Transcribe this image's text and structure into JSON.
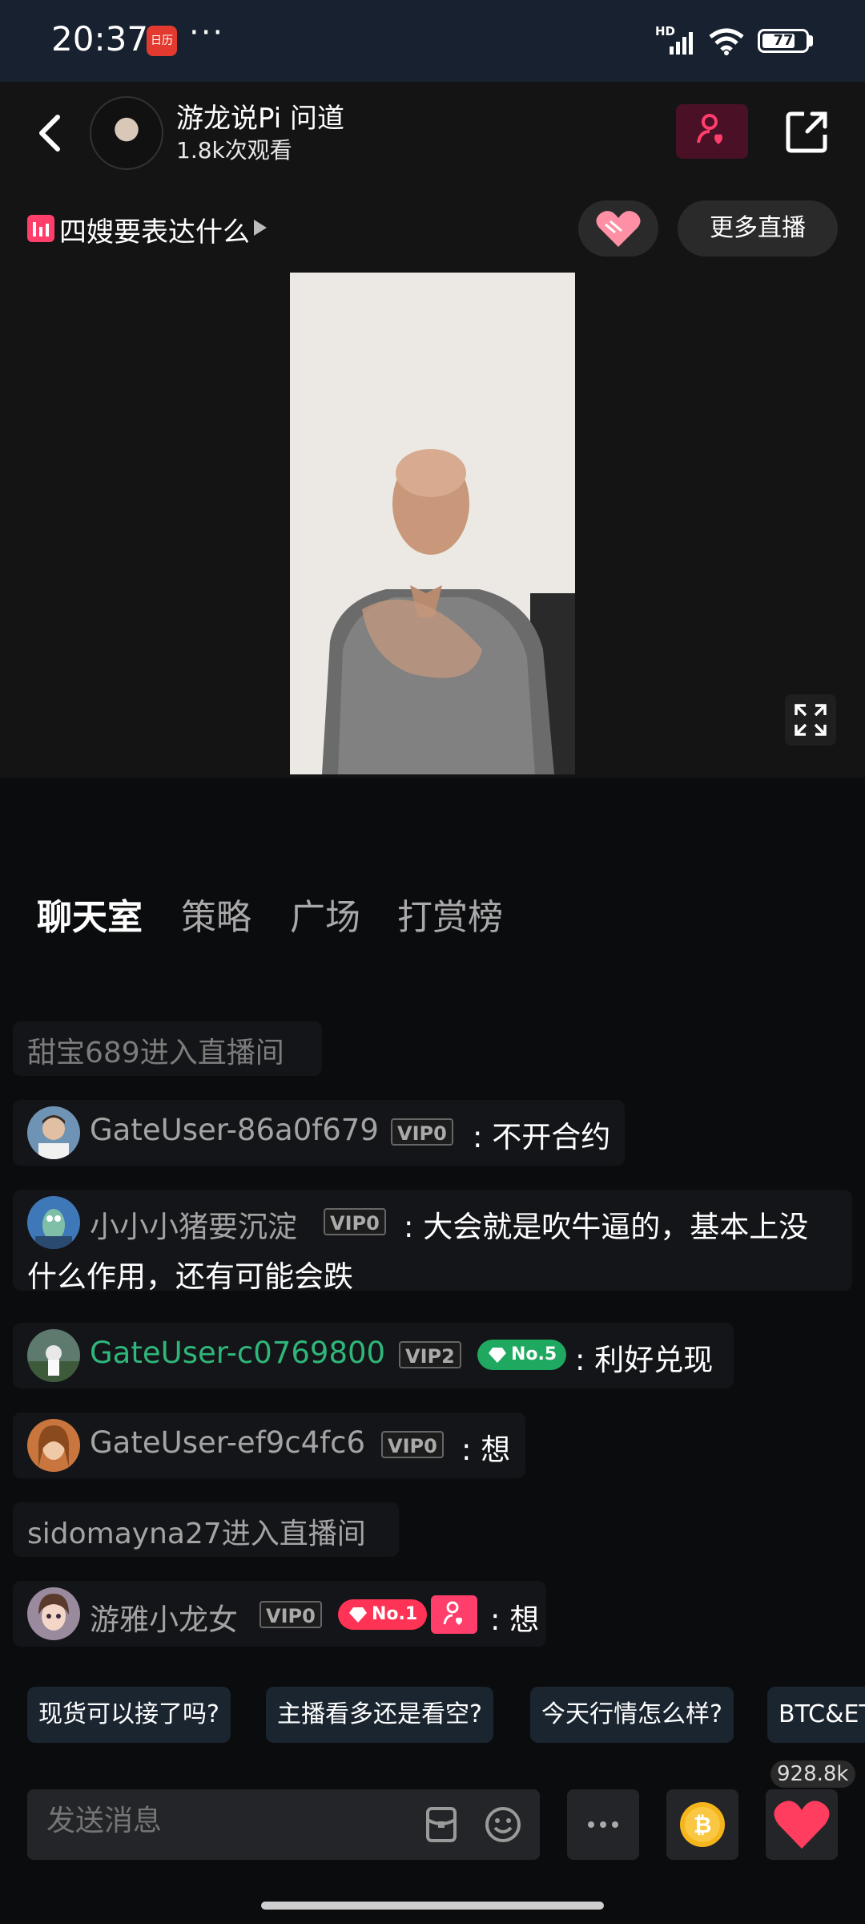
{
  "status_bar": {
    "time": "20:37",
    "notification_app_icon": "calendar-app-icon",
    "more_indicator": "···",
    "hd_label": "HD",
    "battery_level": "77",
    "battery_fraction": 0.77
  },
  "header": {
    "streamer_name": "游龙说Pi  问道",
    "viewer_count": "1.8k次观看"
  },
  "topic": {
    "text": "四嫂要表达什么",
    "more_live_label": "更多直播"
  },
  "tabs": [
    {
      "label": "聊天室",
      "active": true
    },
    {
      "label": "策略",
      "active": false
    },
    {
      "label": "广场",
      "active": false
    },
    {
      "label": "打赏榜",
      "active": false
    }
  ],
  "chat": {
    "enter1": "甜宝689进入直播间",
    "msg1": {
      "user": "GateUser-86a0f679",
      "vip": "VIP0",
      "text": ": 不开合约"
    },
    "msg2": {
      "user": "小小小猪要沉淀",
      "vip": "VIP0",
      "text_line1": ": 大会就是吹牛逼的，基本上没",
      "text_line2": "什么作用，还有可能会跌"
    },
    "msg3": {
      "user": "GateUser-c0769800",
      "vip": "VIP2",
      "badge": "No.5",
      "text": ": 利好兑现",
      "user_color": "#2fb67a"
    },
    "msg4": {
      "user": "GateUser-ef9c4fc6",
      "vip": "VIP0",
      "text": ": 想"
    },
    "enter2": "sidomayna27进入直播间",
    "msg5": {
      "user": "游雅小龙女",
      "vip": "VIP0",
      "badge": "No.1",
      "text": ": 想"
    }
  },
  "quick_replies": [
    "现货可以接了吗?",
    "主播看多还是看空?",
    "今天行情怎么样?",
    "BTC&ET"
  ],
  "input": {
    "placeholder": "发送消息",
    "like_count": "928.8k"
  },
  "colors": {
    "accent_pink": "#ff3e6c",
    "vip_green": "#2fb67a",
    "background": "#0b0c0e"
  }
}
